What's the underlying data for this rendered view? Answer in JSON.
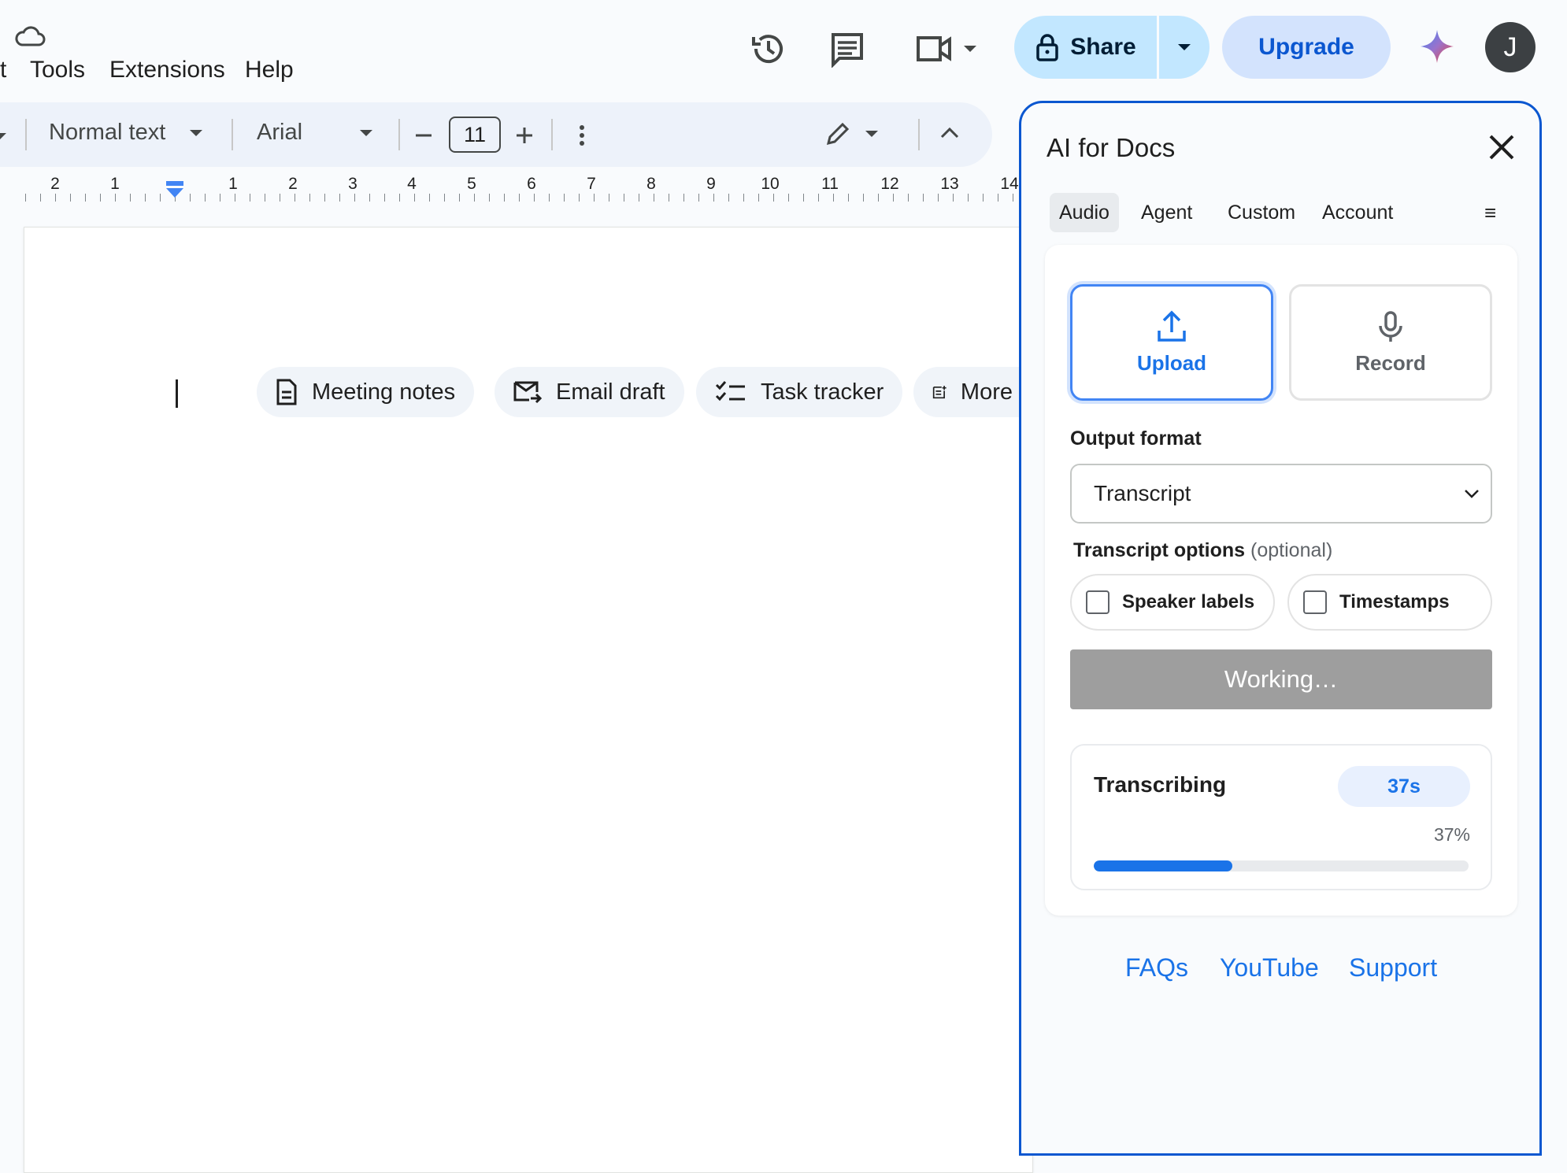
{
  "menu": {
    "partial": "t",
    "items": [
      "Tools",
      "Extensions",
      "Help"
    ]
  },
  "header": {
    "share_label": "Share",
    "upgrade_label": "Upgrade",
    "avatar_initial": "J"
  },
  "toolbar": {
    "style": "Normal text",
    "font": "Arial",
    "font_size": "11"
  },
  "ruler": {
    "labels": [
      "2",
      "1",
      "1",
      "2",
      "3",
      "4",
      "5",
      "6",
      "7",
      "8",
      "9",
      "10",
      "11",
      "12",
      "13",
      "14"
    ]
  },
  "chips": [
    {
      "label": "Meeting notes",
      "icon": "document-icon"
    },
    {
      "label": "Email draft",
      "icon": "email-icon"
    },
    {
      "label": "Task tracker",
      "icon": "checklist-icon"
    },
    {
      "label": "More",
      "icon": "more-templates-icon"
    }
  ],
  "sidebar": {
    "title": "AI for Docs",
    "tabs": [
      "Audio",
      "Agent",
      "Custom",
      "Account"
    ],
    "active_tab": "Audio",
    "upload_label": "Upload",
    "record_label": "Record",
    "output_format_label": "Output format",
    "output_format_value": "Transcript",
    "transcript_options_label": "Transcript options",
    "optional_label": "(optional)",
    "speaker_labels": "Speaker labels",
    "timestamps": "Timestamps",
    "working_label": "Working…",
    "progress": {
      "title": "Transcribing",
      "elapsed": "37s",
      "percent_label": "37%",
      "fraction": 0.37
    },
    "footer_links": [
      "FAQs",
      "YouTube",
      "Support"
    ]
  },
  "colors": {
    "accent": "#1a73e8",
    "share_bg": "#c2e7ff",
    "upgrade_bg": "#d3e3fd",
    "sidebar_border": "#0b57d0"
  }
}
